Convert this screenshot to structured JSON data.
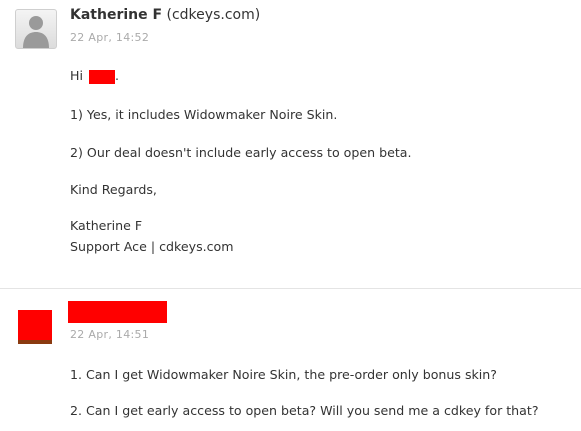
{
  "message1": {
    "author_name": "Katherine F",
    "author_org": "(cdkeys.com)",
    "timestamp": "22 Apr, 14:52",
    "greeting": "Hi",
    "line1": "1) Yes, it includes Widowmaker Noire Skin.",
    "line2": "2) Our deal doesn't include early access to open beta.",
    "closing": "Kind Regards,",
    "signature_name": "Katherine F",
    "signature_title": "Support Ace | cdkeys.com"
  },
  "message2": {
    "timestamp": "22 Apr, 14:51",
    "line1": "1. Can I get Widowmaker Noire Skin, the pre-order only bonus skin?",
    "line2": "2. Can I get early access to open beta? Will you send me a cdkey for that?"
  },
  "colors": {
    "redaction": "#ff0000",
    "timestamp": "#aaaaaa",
    "text": "#333333"
  },
  "icons": {
    "default_avatar": "person-silhouette-icon"
  }
}
